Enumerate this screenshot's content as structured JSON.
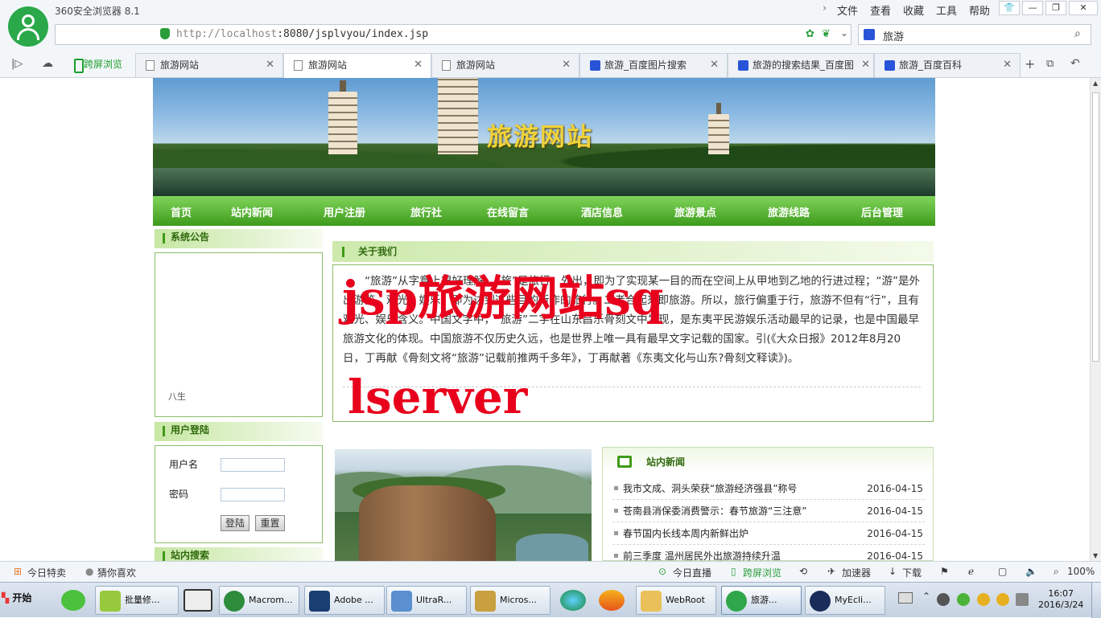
{
  "browser": {
    "app_title": "360安全浏览器 8.1",
    "menu": [
      "文件",
      "查看",
      "收藏",
      "工具",
      "帮助"
    ],
    "url_host": "http://localhost",
    "url_rest": ":8080/jsplvyou/index.jsp",
    "search_value": "旅游",
    "cross_screen": "跨屏浏览",
    "tabs": [
      {
        "label": "旅游网站",
        "icon": "page-icon"
      },
      {
        "label": "旅游网站",
        "icon": "page-icon"
      },
      {
        "label": "旅游网站",
        "icon": "page-icon"
      },
      {
        "label": "旅游_百度图片搜索",
        "icon": "baidu-paw-icon"
      },
      {
        "label": "旅游的搜索结果_百度图",
        "icon": "baidu-paw-icon"
      },
      {
        "label": "旅游_百度百科",
        "icon": "baidu-paw-icon"
      }
    ]
  },
  "site": {
    "banner_title": "旅游网站",
    "nav": [
      "首页",
      "站内新闻",
      "用户注册",
      "旅行社",
      "在线留言",
      "酒店信息",
      "旅游景点",
      "旅游线路",
      "后台管理"
    ],
    "notice_title": "系统公告",
    "notice_text": "八生",
    "login_title": "用户登陆",
    "username_label": "用户名",
    "password_label": "密码",
    "login_button": "登陆",
    "reset_button": "重置",
    "search_title": "站内搜索",
    "about_title": "关于我们",
    "about_text": "“旅游”从字意上很好理解。“旅”是旅行，外出，即为了实现某一目的而在空间上从甲地到乙地的行进过程；“游”是外出游览、观光、娱乐，即为达到这些目的所作的旅行。二者合起来即旅游。所以，旅行偏重于行，旅游不但有“行”，且有观光、娱乐含义。中国文字中，“旅游”二字在山东昌乐骨刻文中发现，是东夷平民游娱乐活动最早的记录，也是中国最早旅游文化的体现。中国旅游不仅历史久远，也是世界上唯一具有最早文字记载的国家。引(《大众日报》2012年8月20日，丁再献《骨刻文将“旅游”记载前推两千多年》，丁再献著《东夷文化与山东?骨刻文释读》)。",
    "watermark_line1": "jsp旅游网站sq",
    "watermark_line2": "lserver",
    "news_title": "站内新闻",
    "news": [
      {
        "title": "我市文成、洞头荣获“旅游经济强县”称号",
        "date": "2016-04-15"
      },
      {
        "title": "苍南县消保委消费警示：春节旅游“三注意”",
        "date": "2016-04-15"
      },
      {
        "title": "春节国内长线本周内新鲜出炉",
        "date": "2016-04-15"
      },
      {
        "title": "前三季度 温州居民外出旅游持续升温",
        "date": "2016-04-15"
      }
    ]
  },
  "statusbar": {
    "left": [
      "今日特卖",
      "猜你喜欢"
    ],
    "right": [
      "今日直播",
      "跨屏浏览",
      "加速器",
      "下载",
      "100%"
    ]
  },
  "taskbar": {
    "start": "开始",
    "tasks": [
      "批量修...",
      "Macrom...",
      "Adobe ...",
      "UltraR...",
      "Micros...",
      "WebRoot",
      "旅游...",
      "MyEcli..."
    ],
    "time": "16:07",
    "date": "2016/3/24"
  },
  "colors": {
    "nav_green": "#4fb02a",
    "heading_green": "#2f6a0c",
    "watermark_red": "#e8001c",
    "banner_title_gold": "#f0d23a"
  }
}
